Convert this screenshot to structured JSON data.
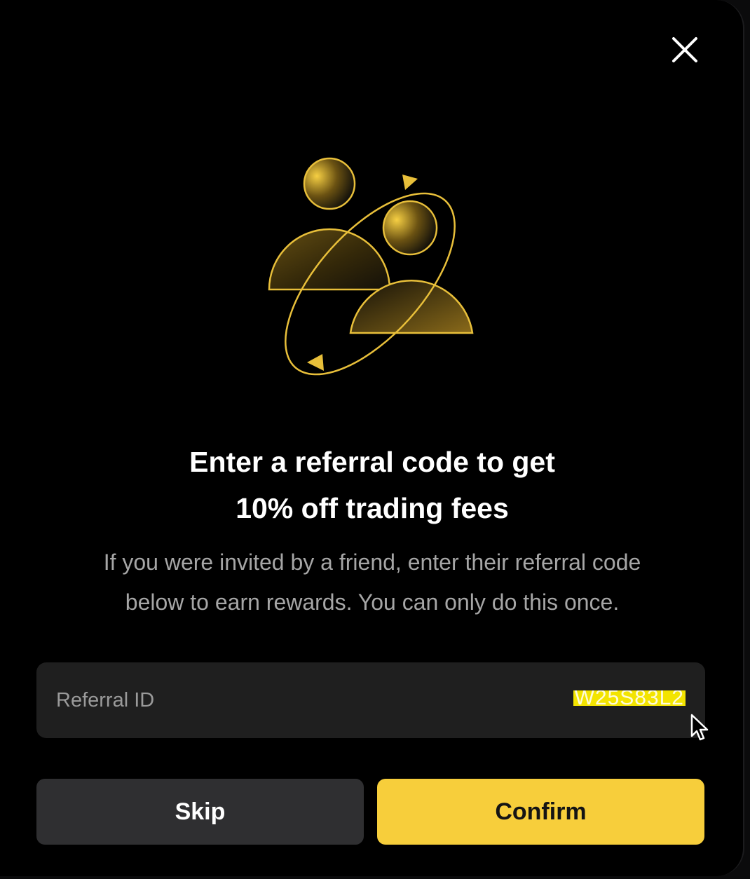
{
  "dialog": {
    "close_icon": "close-icon",
    "illustration_icon": "referral-people-icon",
    "title_line1": "Enter a referral code to get",
    "title_line2": "10% off trading fees",
    "subtitle_line1": "If you were invited by a friend, enter their referral code",
    "subtitle_line2": "below to earn rewards. You can only do this once.",
    "input": {
      "label": "Referral ID",
      "value": "W25S83L2"
    },
    "skip_label": "Skip",
    "confirm_label": "Confirm"
  },
  "colors": {
    "accent": "#f7ce3b",
    "illustration_gold": "#e8bf3a",
    "background": "#000000",
    "input_bg": "#1f1f1f",
    "skip_bg": "#2f2f31"
  }
}
